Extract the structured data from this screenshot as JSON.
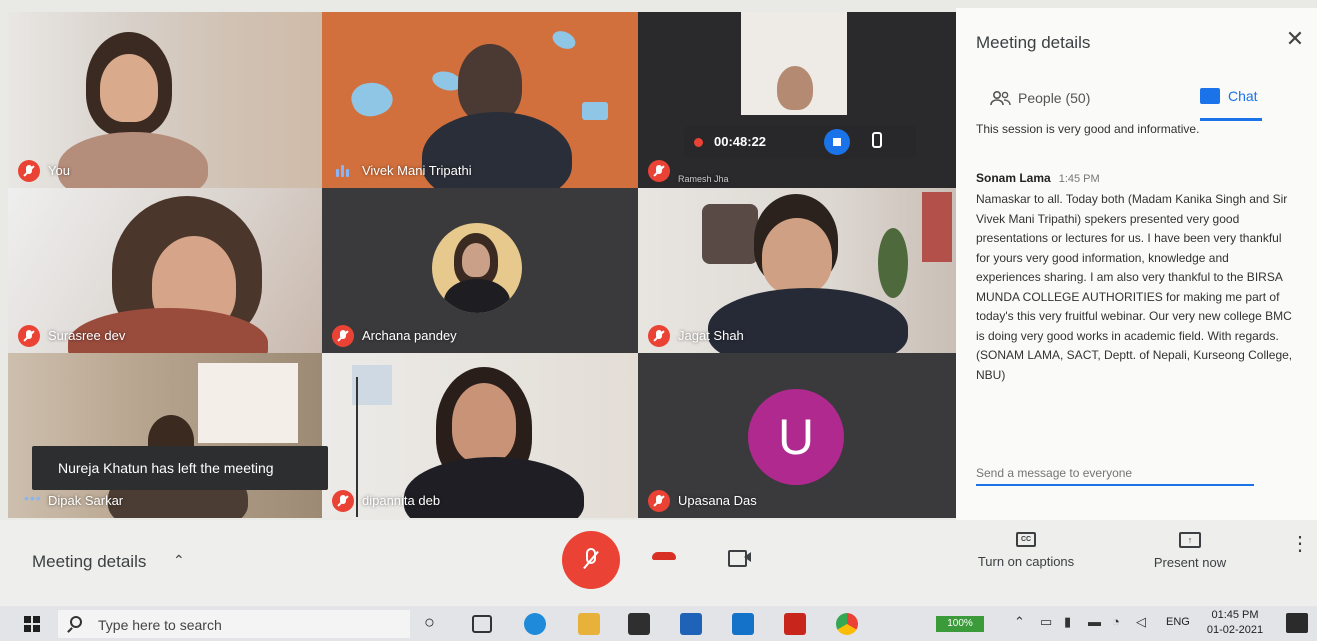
{
  "tiles": {
    "t1_name": "You",
    "t2_name": "Vivek Mani Tripathi",
    "t3_name": "Ramesh Jha",
    "t4_name": "Surasree dev",
    "t5_name": "Archana pandey",
    "t6_name": "Jagat Shah",
    "t7_name": "Dipak Sarkar",
    "t8_name": "dipannita deb",
    "t9_name": "Upasana Das",
    "t9_avatar_letter": "U"
  },
  "recording": {
    "timer": "00:48:22"
  },
  "toast": {
    "text": "Nureja Khatun has left the meeting"
  },
  "panel": {
    "title": "Meeting details",
    "close_glyph": "✕",
    "people_tab": "People (50)",
    "chat_tab": "Chat",
    "previous_message": "This session is very good and informative.",
    "message": {
      "sender": "Sonam Lama",
      "time": "1:45 PM",
      "text": "Namaskar to all. Today both (Madam Kanika Singh and Sir Vivek Mani Tripathi) spekers presented very good presentations or lectures for us. I have been very thankful for yours very good information, knowledge and experiences sharing. I am also very thankful to the BIRSA MUNDA COLLEGE AUTHORITIES for making me part of today's this very fruitful webinar. Our very new college BMC is doing very good works in academic field. With regards. (SONAM LAMA, SACT, Deptt. of Nepali, Kurseong College, NBU)"
    },
    "input_placeholder": "Send a message to everyone"
  },
  "bottombar": {
    "meeting_details_label": "Meeting details",
    "chevron": "⌃",
    "captions_label": "Turn on captions",
    "captions_icon_text": "CC",
    "present_label": "Present now",
    "present_icon_text": "↑",
    "more_glyph": "⋮"
  },
  "taskbar": {
    "search_placeholder": "Type here to search",
    "task_view_glyph": "○",
    "battery_text": "100%",
    "language": "ENG",
    "time": "01:45 PM",
    "date": "01-02-2021"
  },
  "colors": {
    "accent": "#1a73e8",
    "mic_off_red": "#ea4335",
    "avatar_purple": "#b0298f"
  }
}
